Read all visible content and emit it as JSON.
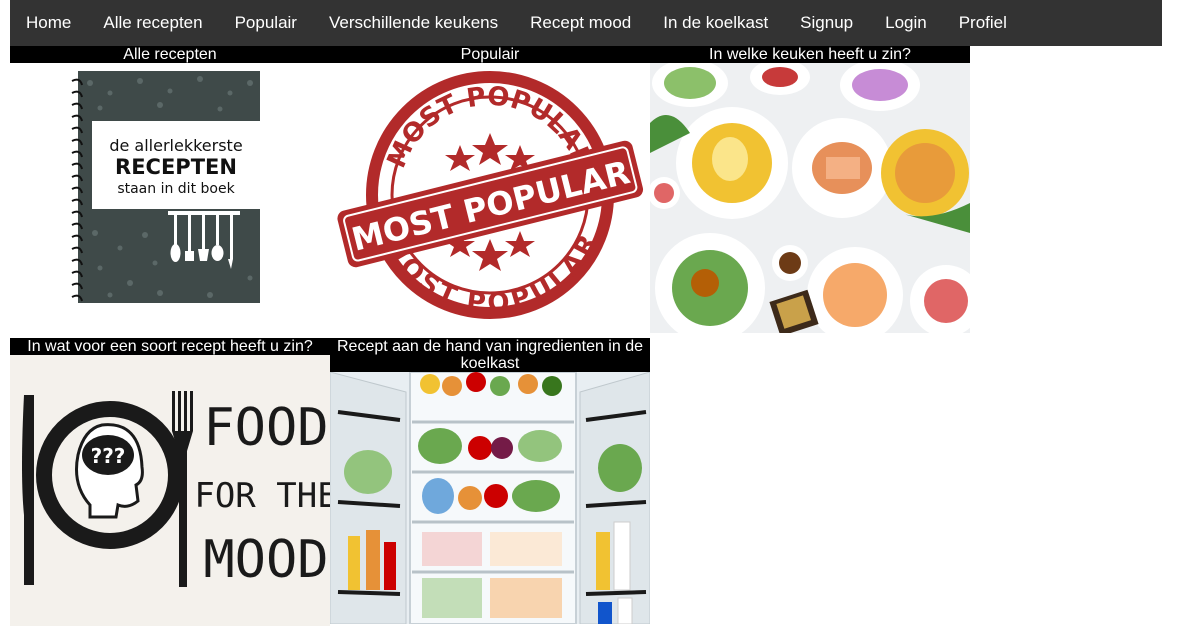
{
  "nav": {
    "items": [
      {
        "label": "Home"
      },
      {
        "label": "Alle recepten"
      },
      {
        "label": "Populair"
      },
      {
        "label": "Verschillende keukens"
      },
      {
        "label": "Recept mood"
      },
      {
        "label": "In de koelkast"
      },
      {
        "label": "Signup"
      },
      {
        "label": "Login"
      },
      {
        "label": "Profiel"
      }
    ]
  },
  "cards": [
    {
      "title": "Alle recepten",
      "image": {
        "line1": "de allerlekkerste",
        "line2": "RECEPTEN",
        "line3": "staan in dit boek"
      }
    },
    {
      "title": "Populair",
      "image": {
        "arc_top": "MOST POPULAR",
        "center": "MOST POPULAR",
        "arc_bottom": "MOST POPULAR"
      }
    },
    {
      "title": "In welke keuken heeft u zin?"
    },
    {
      "title": "In wat voor een soort recept heeft u zin?",
      "image": {
        "line1": "FOOD",
        "line2": "FOR THE",
        "line3": "MOOD",
        "marks": "???"
      }
    },
    {
      "title": "Recept aan de hand van ingredienten in de koelkast"
    }
  ],
  "colors": {
    "navbar": "#333333",
    "title_bar": "#000000",
    "stamp": "#b22a2a",
    "book": "#3f4a49"
  }
}
